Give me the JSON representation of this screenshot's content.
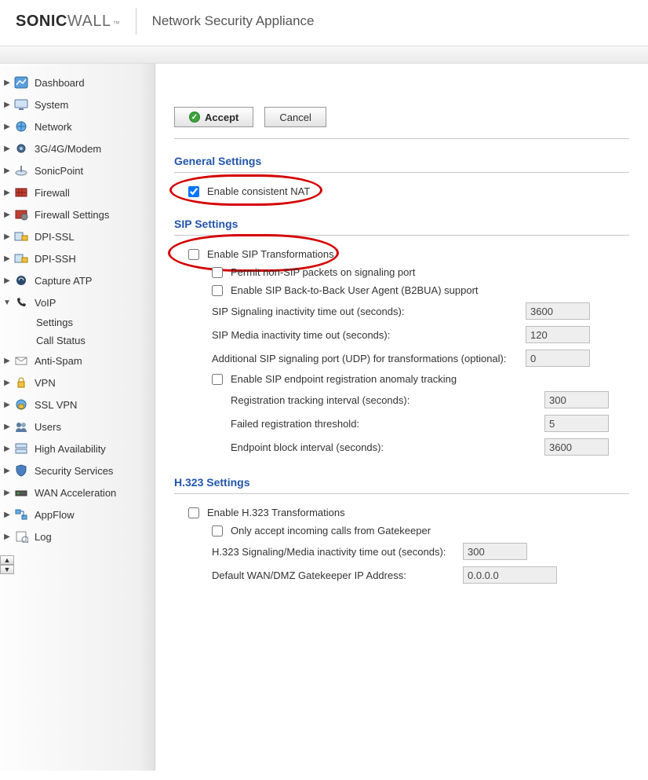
{
  "header": {
    "logo1": "SONIC",
    "logo2": "WALL",
    "subtitle": "Network Security Appliance"
  },
  "sidebar": {
    "items": [
      {
        "label": "Dashboard",
        "icon": "dashboard"
      },
      {
        "label": "System",
        "icon": "system"
      },
      {
        "label": "Network",
        "icon": "network"
      },
      {
        "label": "3G/4G/Modem",
        "icon": "modem"
      },
      {
        "label": "SonicPoint",
        "icon": "sonicpoint"
      },
      {
        "label": "Firewall",
        "icon": "firewall"
      },
      {
        "label": "Firewall Settings",
        "icon": "fwsettings"
      },
      {
        "label": "DPI-SSL",
        "icon": "dpissl"
      },
      {
        "label": "DPI-SSH",
        "icon": "dpissh"
      },
      {
        "label": "Capture ATP",
        "icon": "capture"
      },
      {
        "label": "VoIP",
        "icon": "voip",
        "expanded": true,
        "children": [
          "Settings",
          "Call Status"
        ]
      },
      {
        "label": "Anti-Spam",
        "icon": "antispam"
      },
      {
        "label": "VPN",
        "icon": "vpn"
      },
      {
        "label": "SSL VPN",
        "icon": "sslvpn"
      },
      {
        "label": "Users",
        "icon": "users"
      },
      {
        "label": "High Availability",
        "icon": "ha"
      },
      {
        "label": "Security Services",
        "icon": "security"
      },
      {
        "label": "WAN Acceleration",
        "icon": "wan"
      },
      {
        "label": "AppFlow",
        "icon": "appflow"
      },
      {
        "label": "Log",
        "icon": "log"
      }
    ]
  },
  "buttons": {
    "accept": "Accept",
    "cancel": "Cancel"
  },
  "general": {
    "title": "General Settings",
    "enable_nat_label": "Enable consistent NAT",
    "enable_nat_checked": true
  },
  "sip": {
    "title": "SIP Settings",
    "enable_transform_label": "Enable SIP Transformations",
    "enable_transform_checked": false,
    "permit_nonsip_label": "Permit non-SIP packets on signaling port",
    "permit_nonsip_checked": false,
    "enable_b2bua_label": "Enable SIP Back-to-Back User Agent (B2BUA) support",
    "enable_b2bua_checked": false,
    "sig_timeout_label": "SIP Signaling inactivity time out (seconds):",
    "sig_timeout_value": "3600",
    "media_timeout_label": "SIP Media inactivity time out (seconds):",
    "media_timeout_value": "120",
    "addl_port_label": "Additional SIP signaling port (UDP) for transformations (optional):",
    "addl_port_value": "0",
    "anomaly_label": "Enable SIP endpoint registration anomaly tracking",
    "anomaly_checked": false,
    "reg_interval_label": "Registration tracking interval (seconds):",
    "reg_interval_value": "300",
    "failed_threshold_label": "Failed registration threshold:",
    "failed_threshold_value": "5",
    "block_interval_label": "Endpoint block interval (seconds):",
    "block_interval_value": "3600"
  },
  "h323": {
    "title": "H.323 Settings",
    "enable_transform_label": "Enable H.323 Transformations",
    "enable_transform_checked": false,
    "only_gatekeeper_label": "Only accept incoming calls from Gatekeeper",
    "only_gatekeeper_checked": false,
    "sig_timeout_label": "H.323 Signaling/Media inactivity time out (seconds):",
    "sig_timeout_value": "300",
    "gatekeeper_ip_label": "Default WAN/DMZ Gatekeeper IP Address:",
    "gatekeeper_ip_value": "0.0.0.0"
  }
}
